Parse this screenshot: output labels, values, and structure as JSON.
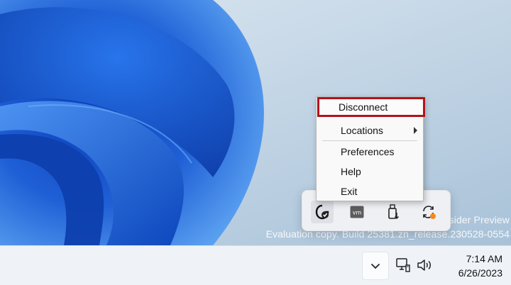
{
  "desktop": {
    "watermark_line1": "sider Preview",
    "watermark_line2": "Evaluation copy. Build 25381.zn_release.230528-0554"
  },
  "context_menu": {
    "items": [
      {
        "label": "Disconnect",
        "highlighted": true
      },
      {
        "label": "Locations",
        "has_submenu": true
      },
      {
        "label": "Preferences"
      },
      {
        "label": "Help"
      },
      {
        "label": "Exit"
      }
    ]
  },
  "tray_overflow": {
    "icons": [
      "vpn-client-icon",
      "vmware-icon",
      "usb-drive-icon",
      "sync-icon"
    ]
  },
  "taskbar": {
    "overflow_chevron_icon": "chevron-down-icon",
    "network_icon": "network-icon",
    "volume_icon": "volume-icon",
    "clock": {
      "time": "7:14 AM",
      "date": "6/26/2023"
    }
  },
  "colors": {
    "highlight_border": "#b0141c",
    "wallpaper_blue": "#1f5fd6",
    "sync_badge": "#f28c1b"
  }
}
